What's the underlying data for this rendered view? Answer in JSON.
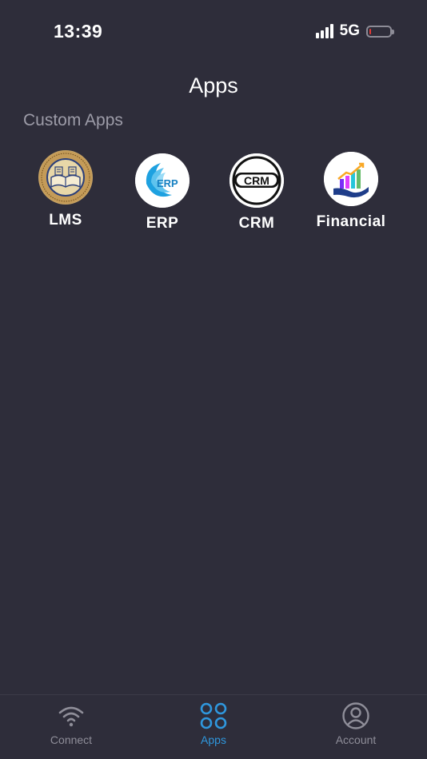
{
  "status_bar": {
    "time": "13:39",
    "network": "5G",
    "battery_level": 0.1,
    "battery_color": "#e53935"
  },
  "header": {
    "title": "Apps"
  },
  "section": {
    "title": "Custom Apps"
  },
  "apps": [
    {
      "label": "LMS",
      "icon": "university-seal-icon"
    },
    {
      "label": "ERP",
      "icon": "erp-wave-icon"
    },
    {
      "label": "CRM",
      "icon": "crm-badge-icon"
    },
    {
      "label": "Financial",
      "icon": "financial-chart-icon"
    }
  ],
  "tab_bar": {
    "items": [
      {
        "label": "Connect",
        "icon": "wifi-icon",
        "active": false
      },
      {
        "label": "Apps",
        "icon": "grid-icon",
        "active": true
      },
      {
        "label": "Account",
        "icon": "user-circle-icon",
        "active": false
      }
    ],
    "active_color": "#2f97dd",
    "inactive_color": "#8f8e99"
  },
  "colors": {
    "background": "#2e2d3a",
    "section_text": "#9d9ca8"
  }
}
